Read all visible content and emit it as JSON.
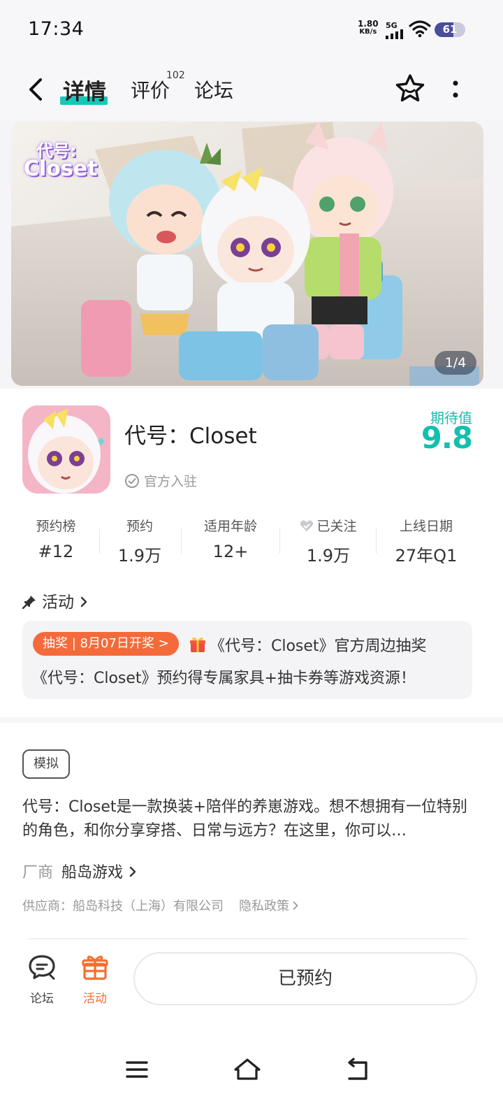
{
  "status_bar": {
    "time": "17:34",
    "net_speed_value": "1.80",
    "net_speed_unit": "KB/s",
    "network": "5G",
    "battery": "61",
    "battery_level": 0.61
  },
  "nav": {
    "tabs": [
      {
        "label": "详情",
        "active": true
      },
      {
        "label": "评价",
        "badge": "102"
      },
      {
        "label": "论坛"
      }
    ]
  },
  "banner": {
    "logo_line1": "代号:",
    "logo_line2": "Closet",
    "pager": "1/4"
  },
  "game": {
    "name": "代号：Closet",
    "verified": "官方入驻",
    "expect_label": "期待值",
    "expect_value": "9.8"
  },
  "stats": [
    {
      "label": "预约榜",
      "value": "#12"
    },
    {
      "label": "预约",
      "value": "1.9万"
    },
    {
      "label": "适用年龄",
      "value": "12+"
    },
    {
      "label": "已关注",
      "value": "1.9万"
    },
    {
      "label": "上线日期",
      "value": "27年Q1"
    }
  ],
  "activity": {
    "heading": "活动",
    "tag": "抽奖 | 8月07日开奖 >",
    "title": "《代号：Closet》官方周边抽奖",
    "subtitle": "《代号：Closet》预约得专属家具+抽卡券等游戏资源！"
  },
  "info": {
    "tag": "模拟",
    "description": "代号：Closet是一款换装+陪伴的养崽游戏。想不想拥有一位特别的角色，和你分享穿搭、日常与远方？在这里，你可以…",
    "vendor_label": "厂商",
    "vendor_name": "船岛游戏",
    "supplier": "供应商：船岛科技（上海）有限公司",
    "privacy": "隐私政策"
  },
  "bottom_bar": {
    "forum_label": "论坛",
    "activity_label": "活动",
    "reserved_label": "已预约"
  },
  "colors": {
    "accent": "#15c8b8",
    "activity_orange": "#f56a3a",
    "battery": "#4a4d9a"
  }
}
